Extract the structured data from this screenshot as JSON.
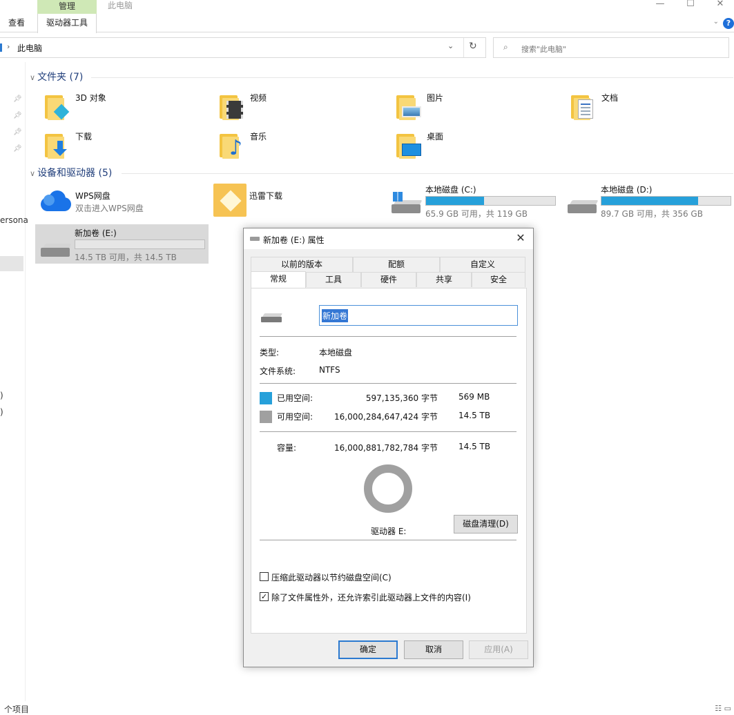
{
  "ribbon": {
    "context_tab_header": "管理",
    "window_title": "此电脑",
    "tabs": [
      "查看",
      "驱动器工具"
    ],
    "controls": {
      "minimize": "—",
      "maximize": "☐",
      "close": "✕"
    },
    "help": "?"
  },
  "address": {
    "path": "此电脑",
    "separator": "›",
    "dropdown": "⌄",
    "refresh": "↻"
  },
  "search": {
    "placeholder": "搜索\"此电脑\""
  },
  "nav": {
    "partial_text": "ersona",
    "partial_a": ")",
    "partial_b": ")"
  },
  "groups": {
    "folders": {
      "label": "文件夹 (7)"
    },
    "devices": {
      "label": "设备和驱动器 (5)"
    }
  },
  "folders": [
    {
      "label": "3D 对象",
      "icon": "3d-objects-icon"
    },
    {
      "label": "视频",
      "icon": "videos-icon"
    },
    {
      "label": "图片",
      "icon": "pictures-icon"
    },
    {
      "label": "文档",
      "icon": "documents-icon"
    },
    {
      "label": "下载",
      "icon": "downloads-icon"
    },
    {
      "label": "音乐",
      "icon": "music-icon"
    },
    {
      "label": "桌面",
      "icon": "desktop-icon"
    }
  ],
  "devices": {
    "wps": {
      "label": "WPS网盘",
      "sub": "双击进入WPS网盘"
    },
    "xunlei": {
      "label": "迅雷下载"
    },
    "c": {
      "label": "本地磁盘 (C:)",
      "info": "65.9 GB 可用，共 119 GB",
      "used_fraction": 0.45
    },
    "d": {
      "label": "本地磁盘 (D:)",
      "info": "89.7 GB 可用，共 356 GB",
      "used_fraction": 0.75
    },
    "e": {
      "label": "新加卷 (E:)",
      "info": "14.5 TB 可用，共 14.5 TB",
      "used_fraction": 0.0
    }
  },
  "status": {
    "items": "个项目"
  },
  "dialog": {
    "title": "新加卷 (E:) 属性",
    "close": "✕",
    "tabs_row1": [
      "以前的版本",
      "配额",
      "自定义"
    ],
    "tabs_row2": [
      "常规",
      "工具",
      "硬件",
      "共享",
      "安全"
    ],
    "name_value": "新加卷",
    "type_label": "类型:",
    "type_value": "本地磁盘",
    "fs_label": "文件系统:",
    "fs_value": "NTFS",
    "used_label": "已用空间:",
    "used_bytes": "597,135,360 字节",
    "used_human": "569 MB",
    "free_label": "可用空间:",
    "free_bytes": "16,000,284,647,424 字节",
    "free_human": "14.5 TB",
    "capacity_label": "容量:",
    "capacity_bytes": "16,000,881,782,784 字节",
    "capacity_human": "14.5 TB",
    "drive_label": "驱动器 E:",
    "cleanup_button": "磁盘清理(D)",
    "compress_label": "压缩此驱动器以节约磁盘空间(C)",
    "compress_checked": false,
    "index_label": "除了文件属性外，还允许索引此驱动器上文件的内容(I)",
    "index_checked": true,
    "ok": "确定",
    "cancel": "取消",
    "apply": "应用(A)",
    "colors": {
      "used": "#26a0da",
      "free": "#a0a0a0"
    },
    "used_fraction": 0.0
  }
}
